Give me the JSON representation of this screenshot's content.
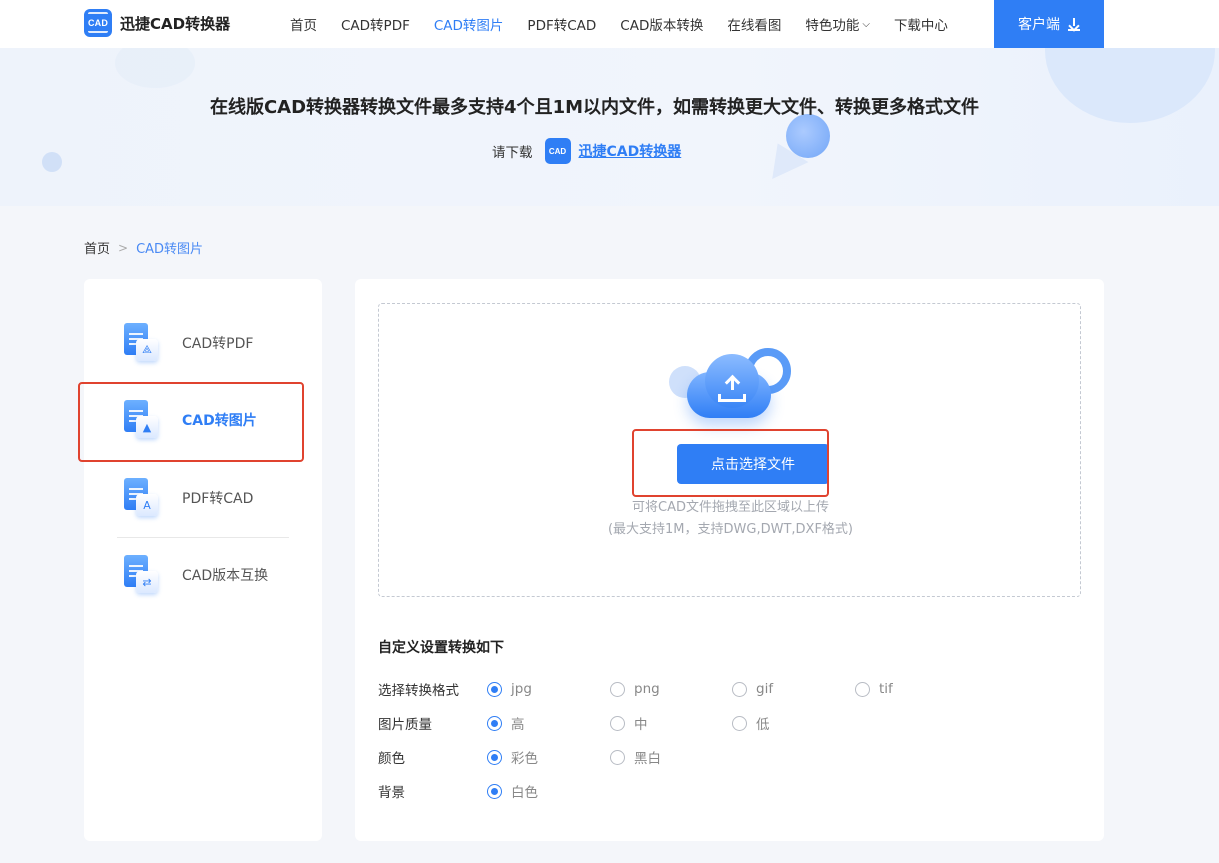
{
  "header": {
    "logo_badge": "CAD",
    "logo_text": "迅捷CAD转换器",
    "nav": [
      {
        "label": "首页",
        "active": false
      },
      {
        "label": "CAD转PDF",
        "active": false
      },
      {
        "label": "CAD转图片",
        "active": true
      },
      {
        "label": "PDF转CAD",
        "active": false
      },
      {
        "label": "CAD版本转换",
        "active": false
      },
      {
        "label": "在线看图",
        "active": false
      },
      {
        "label": "特色功能",
        "active": false,
        "has_dropdown": true
      },
      {
        "label": "下载中心",
        "active": false
      }
    ],
    "client_button": "客户端"
  },
  "banner": {
    "title": "在线版CAD转换器转换文件最多支持4个且1M以内文件，如需转换更大文件、转换更多格式文件",
    "sub_prefix": "请下载",
    "badge": "CAD",
    "link": "迅捷CAD转换器"
  },
  "breadcrumb": {
    "home": "首页",
    "separator": ">",
    "current": "CAD转图片"
  },
  "sidebar": {
    "items": [
      {
        "label": "CAD转PDF",
        "icon": "cad-to-pdf-icon",
        "active": false
      },
      {
        "label": "CAD转图片",
        "icon": "cad-to-image-icon",
        "active": true
      },
      {
        "label": "PDF转CAD",
        "icon": "pdf-to-cad-icon",
        "active": false
      },
      {
        "label": "CAD版本互换",
        "icon": "cad-version-swap-icon",
        "active": false
      }
    ]
  },
  "upload": {
    "button": "点击选择文件",
    "hint_line1": "可将CAD文件拖拽至此区域以上传",
    "hint_line2": "(最大支持1M，支持DWG,DWT,DXF格式)"
  },
  "settings": {
    "title": "自定义设置转换如下",
    "rows": [
      {
        "label": "选择转换格式",
        "options": [
          "jpg",
          "png",
          "gif",
          "tif"
        ],
        "selected": 0
      },
      {
        "label": "图片质量",
        "options": [
          "高",
          "中",
          "低"
        ],
        "selected": 0
      },
      {
        "label": "颜色",
        "options": [
          "彩色",
          "黑白"
        ],
        "selected": 0
      },
      {
        "label": "背景",
        "options": [
          "白色"
        ],
        "selected": 0
      }
    ]
  },
  "colors": {
    "accent": "#2f7ef5",
    "highlight": "#e0432f"
  }
}
